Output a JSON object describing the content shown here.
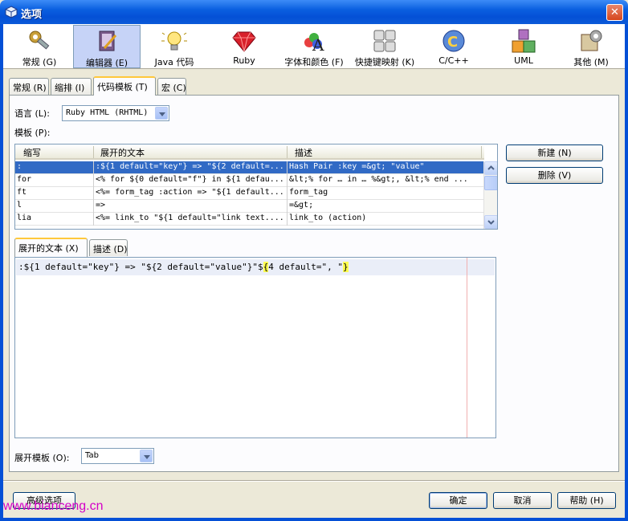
{
  "window": {
    "title": "选项"
  },
  "categories": [
    {
      "label": "常规 (G)",
      "icon": "gear-wrench-icon",
      "selected": false
    },
    {
      "label": "编辑器 (E)",
      "icon": "editor-pen-icon",
      "selected": true
    },
    {
      "label": "Java 代码",
      "icon": "lightbulb-icon",
      "selected": false
    },
    {
      "label": "Ruby",
      "icon": "ruby-gem-icon",
      "selected": false
    },
    {
      "label": "字体和颜色 (F)",
      "icon": "font-color-icon",
      "selected": false
    },
    {
      "label": "快捷键映射 (K)",
      "icon": "keyboard-icon",
      "selected": false
    },
    {
      "label": "C/C++",
      "icon": "cpp-icon",
      "selected": false
    },
    {
      "label": "UML",
      "icon": "uml-blocks-icon",
      "selected": false
    },
    {
      "label": "其他 (M)",
      "icon": "misc-settings-icon",
      "selected": false
    }
  ],
  "tabs": [
    {
      "label": "常规 (R)"
    },
    {
      "label": "缩排 (I)"
    },
    {
      "label": "代码模板 (T)",
      "active": true
    },
    {
      "label": "宏 (C)"
    }
  ],
  "language": {
    "label": "语言 (L):",
    "value": "Ruby HTML (RHTML)"
  },
  "templates": {
    "label": "模板 (P):",
    "columns": [
      "缩写",
      "展开的文本",
      "描述"
    ],
    "rows": [
      {
        "abbr": ":",
        "text": ":${1 default=\"key\"} => \"${2 default=...",
        "desc": "Hash Pair :key =&gt; \"value\"",
        "selected": true
      },
      {
        "abbr": "for",
        "text": "<% for ${0 default=\"f\"} in ${1 defau...",
        "desc": "&lt;% for … in … %&gt;, &lt;% end ...",
        "selected": false
      },
      {
        "abbr": "ft",
        "text": "<%= form_tag :action => \"${1 default...",
        "desc": "form_tag",
        "selected": false
      },
      {
        "abbr": "l",
        "text": "=>",
        "desc": "=&gt;",
        "selected": false
      },
      {
        "abbr": "lia",
        "text": "<%= link_to \"${1 default=\"link text....",
        "desc": "link_to (action)",
        "selected": false
      }
    ]
  },
  "buttons": {
    "new": "新建 (N)",
    "delete": "删除 (V)",
    "advanced": "高级选项",
    "ok": "确定",
    "cancel": "取消",
    "help": "帮助 (H)"
  },
  "subtabs": [
    {
      "label": "展开的文本 (X)",
      "active": true
    },
    {
      "label": "描述 (D)"
    }
  ],
  "editor": {
    "before": ":${1 default=\"key\"} => \"${2 default=\"value\"}\"$",
    "brace1": "{",
    "middle": "4 default=\", \"",
    "brace2": "}"
  },
  "expand": {
    "label": "展开模板 (O):",
    "value": "Tab"
  },
  "watermark": "www.bianceng.cn"
}
